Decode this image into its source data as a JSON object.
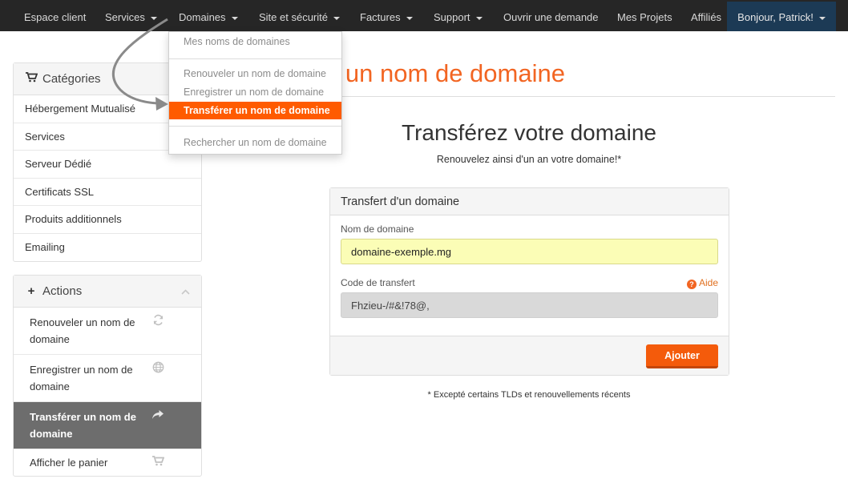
{
  "nav": {
    "items": [
      {
        "label": "Espace client"
      },
      {
        "label": "Services"
      },
      {
        "label": "Domaines"
      },
      {
        "label": "Site et sécurité"
      },
      {
        "label": "Factures"
      },
      {
        "label": "Support"
      },
      {
        "label": "Ouvrir une demande"
      },
      {
        "label": "Mes Projets"
      },
      {
        "label": "Affiliés"
      }
    ],
    "greeting": "Bonjour, Patrick!"
  },
  "dropdown": {
    "items": [
      "Mes noms de domaines",
      "Renouveler un nom de domaine",
      "Enregistrer un nom de domaine",
      "Transférer un nom de domaine",
      "Rechercher un nom de domaine"
    ],
    "highlighted_index": 3
  },
  "page_title_visible": "r un nom de domaine",
  "sidebar": {
    "categories": {
      "title": "Catégories",
      "icon": "cart-icon",
      "items": [
        "Hébergement Mutualisé",
        "Services",
        "Serveur Dédié",
        "Certificats SSL",
        "Produits additionnels",
        "Emailing"
      ]
    },
    "actions": {
      "title": "Actions",
      "icon": "plus-icon",
      "items": [
        {
          "label": "Renouveler un nom de domaine",
          "icon": "refresh-icon"
        },
        {
          "label": "Enregistrer un nom de domaine",
          "icon": "globe-icon"
        },
        {
          "label": "Transférer un nom de domaine",
          "icon": "share-arrow-icon",
          "active": true
        },
        {
          "label": "Afficher le panier",
          "icon": "cart-icon"
        }
      ]
    }
  },
  "main": {
    "heading": "Transférez votre domaine",
    "subheading": "Renouvelez ainsi d'un an votre domaine!*",
    "panel_title": "Transfert d'un domaine",
    "domain_label": "Nom de domaine",
    "domain_value": "domaine-exemple.mg",
    "code_label": "Code de transfert",
    "code_value": "Fhzieu-/#&!78@,",
    "help_label": "Aide",
    "submit_label": "Ajouter",
    "footnote": "* Excepté certains TLDs et renouvellements récents"
  },
  "colors": {
    "navbar": "#262626",
    "greeting_bg": "#1c3a55",
    "accent_orange": "#f26522",
    "button_orange": "#f45b0b",
    "dropdown_highlight": "#ff5b00",
    "domain_input_bg": "#fbfdb6",
    "active_action_bg": "#6d6d6d"
  }
}
